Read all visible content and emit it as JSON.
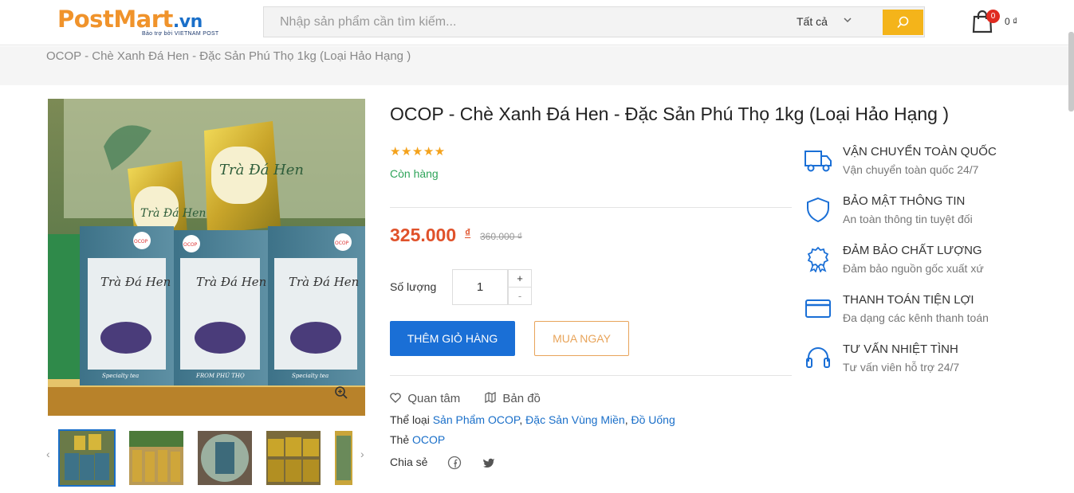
{
  "header": {
    "logo": {
      "post": "Post",
      "mart": "Mart",
      "vn": ".vn",
      "tagline": "Bảo trợ bởi VIETNAM POST"
    },
    "search": {
      "placeholder": "Nhập sản phẩm cần tìm kiếm...",
      "category": "Tất cả"
    },
    "cart": {
      "count": "0",
      "total": "0 ₫"
    }
  },
  "breadcrumb": "OCOP - Chè Xanh Đá Hen - Đặc Sản Phú Thọ 1kg (Loại Hảo Hạng )",
  "product": {
    "title": "OCOP - Chè Xanh Đá Hen - Đặc Sản Phú Thọ 1kg (Loại Hảo Hạng )",
    "rating": 5,
    "stars": "★★★★★",
    "stock": "Còn hàng",
    "price": "325.000",
    "currency": "₫",
    "old_price": "360.000 ₫",
    "qty_label": "Số lượng",
    "qty_value": "1",
    "qty_plus": "+",
    "qty_minus": "-",
    "add_to_cart": "THÊM GIỎ HÀNG",
    "buy_now": "MUA NGAY",
    "wishlist": "Quan tâm",
    "map": "Bản đồ",
    "categories_label": "Thể loại",
    "categories": [
      "Sản Phẩm OCOP",
      "Đặc Sản Vùng Miền",
      "Đồ Uống"
    ],
    "category_sep": ", ",
    "tags_label": "Thẻ",
    "tags": [
      "OCOP"
    ],
    "share_label": "Chia sẻ"
  },
  "image_text": {
    "bag_1": "Trà Đá Hen",
    "bag_2": "Trà Đá Hen",
    "badge": "OCOP",
    "box_title": "Trà Đá Hen",
    "box_sub": "Specialty tea",
    "box_from": "FROM PHÚ THỌ"
  },
  "features": [
    {
      "icon": "truck-icon",
      "title": "VẬN CHUYỂN TOÀN QUỐC",
      "desc": "Vận chuyển toàn quốc 24/7"
    },
    {
      "icon": "shield-icon",
      "title": "BẢO MẬT THÔNG TIN",
      "desc": "An toàn thông tin tuyệt đối"
    },
    {
      "icon": "award-icon",
      "title": "ĐẢM BẢO CHẤT LƯỢNG",
      "desc": "Đảm bảo nguồn gốc xuất xứ"
    },
    {
      "icon": "credit-card-icon",
      "title": "THANH TOÁN TIỆN LỢI",
      "desc": "Đa dạng các kênh thanh toán"
    },
    {
      "icon": "headset-icon",
      "title": "TƯ VẤN NHIỆT TÌNH",
      "desc": "Tư vấn viên hỗ trợ 24/7"
    }
  ],
  "thumbnails": [
    "product-thumb-1",
    "product-thumb-2",
    "product-thumb-3",
    "product-thumb-4",
    "product-thumb-5"
  ],
  "colors": {
    "accent": "#1a6fd6",
    "price": "#e0522b",
    "stock": "#2fa45a",
    "star": "#f4a21c",
    "search_button": "#f4b41a",
    "logo_orange": "#f0932b",
    "logo_blue": "#1a6fc9"
  }
}
